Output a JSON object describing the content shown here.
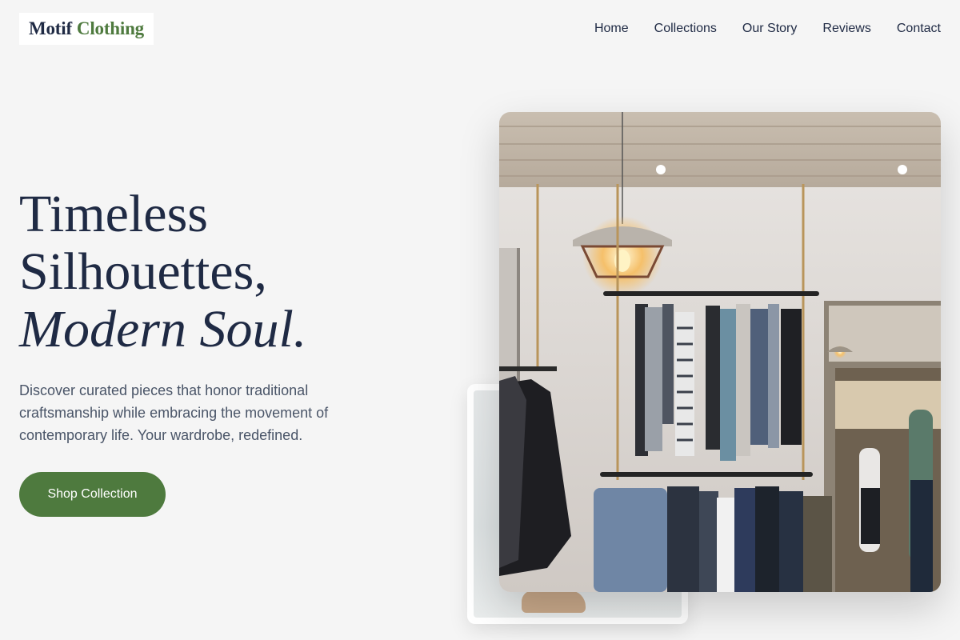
{
  "brand": {
    "name_first": "Motif",
    "name_second": "Clothing"
  },
  "nav": {
    "items": [
      "Home",
      "Collections",
      "Our Story",
      "Reviews",
      "Contact"
    ]
  },
  "hero": {
    "title_line1": "Timeless",
    "title_line2": "Silhouettes,",
    "title_line3": "Modern Soul.",
    "description": "Discover curated pieces that honor traditional craftsmanship while embracing the movement of contemporary life. Your wardrobe, redefined.",
    "cta_label": "Shop Collection"
  },
  "colors": {
    "accent": "#4e7a3e",
    "text_dark": "#1f2a44",
    "text_muted": "#4a5568",
    "background": "#f5f5f5"
  }
}
